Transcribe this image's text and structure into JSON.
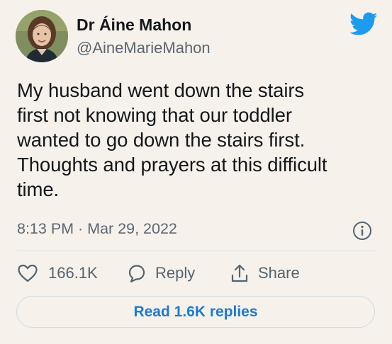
{
  "author": {
    "display_name": "Dr Áine Mahon",
    "handle": "@AineMarieMahon",
    "avatar_icon": "profile-photo"
  },
  "tweet": {
    "lines": [
      "My husband went down the stairs",
      "first not knowing that our toddler",
      "wanted to go down the stairs first.",
      "Thoughts and prayers at this difficult",
      "time."
    ],
    "timestamp": "8:13 PM · Mar 29, 2022"
  },
  "actions": {
    "like_count": "166.1K",
    "reply_label": "Reply",
    "share_label": "Share"
  },
  "read_replies_label": "Read 1.6K replies",
  "colors": {
    "background": "#f7f1ec",
    "twitter_blue": "#1d9bf0",
    "link_blue": "#1d7bd1",
    "secondary_text": "#5b6670"
  },
  "icons": [
    "twitter-bird-icon",
    "info-icon",
    "heart-icon",
    "speech-bubble-icon",
    "share-arrow-icon"
  ]
}
